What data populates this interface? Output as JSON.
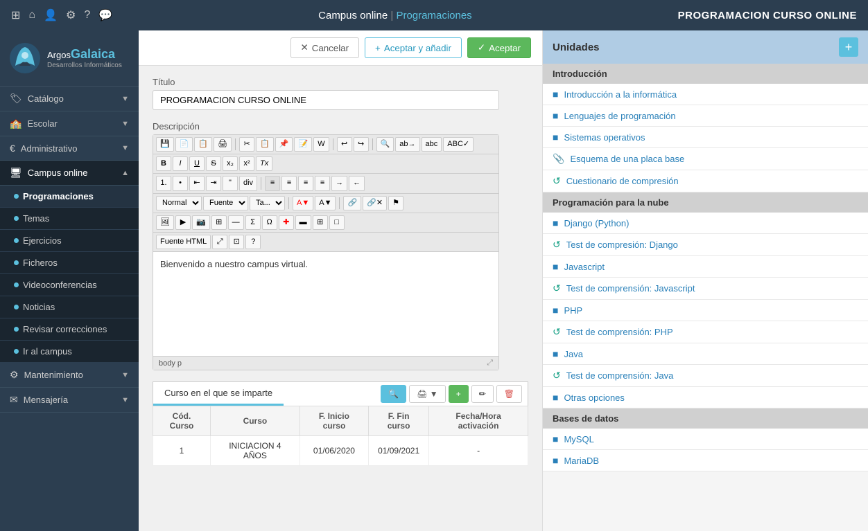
{
  "navbar": {
    "title": "Campus online",
    "separator": "|",
    "subtitle": "Programaciones",
    "page_title": "PROGRAMACION CURSO ONLINE"
  },
  "action_bar": {
    "cancel_label": "Cancelar",
    "add_accept_label": "Aceptar y añadir",
    "accept_label": "Aceptar"
  },
  "form": {
    "title_label": "Título",
    "title_value": "PROGRAMACION CURSO ONLINE",
    "desc_label": "Descripción",
    "editor_content": "Bienvenido a nuestro campus virtual.",
    "editor_footer_left": "body  p",
    "editor_style_select": "Normal",
    "editor_font_select": "Fuente",
    "editor_size_select": "Ta..."
  },
  "course_section": {
    "tab_label": "Curso en el que se imparte",
    "table_headers": [
      "Cód. Curso",
      "Curso",
      "F. Inicio curso",
      "F. Fin curso",
      "Fecha/Hora activación"
    ],
    "table_rows": [
      {
        "cod": "1",
        "curso": "INICIACION 4 AÑOS",
        "f_inicio": "01/06/2020",
        "f_fin": "01/09/2021",
        "activacion": "-"
      }
    ]
  },
  "sidebar": {
    "logo_argos": "Argos",
    "logo_galaica": "Galaica",
    "logo_sub": "Desarrollos Informáticos",
    "menu_items": [
      {
        "label": "Catálogo",
        "icon": "🏷",
        "has_arrow": true
      },
      {
        "label": "Escolar",
        "icon": "🏫",
        "has_arrow": true
      },
      {
        "label": "Administrativo",
        "icon": "€",
        "has_arrow": true
      },
      {
        "label": "Campus online",
        "icon": "🖥",
        "has_arrow": true,
        "active": true
      },
      {
        "label": "Mantenimiento",
        "icon": "⚙",
        "has_arrow": true
      },
      {
        "label": "Mensajería",
        "icon": "✉",
        "has_arrow": true
      }
    ],
    "sub_items": [
      {
        "label": "Programaciones",
        "active": true
      },
      {
        "label": "Temas"
      },
      {
        "label": "Ejercicios"
      },
      {
        "label": "Ficheros"
      },
      {
        "label": "Videoconferencias"
      },
      {
        "label": "Noticias"
      },
      {
        "label": "Revisar correcciones"
      },
      {
        "label": "Ir al campus"
      }
    ]
  },
  "right_panel": {
    "header": "Unidades",
    "add_btn": "+",
    "sections": [
      {
        "title": "Introducción",
        "items": [
          {
            "icon": "book",
            "text": "Introducción a la informática",
            "type": "book"
          },
          {
            "icon": "book",
            "text": "Lenguajes de programación",
            "type": "book"
          },
          {
            "icon": "book",
            "text": "Sistemas operativos",
            "type": "book"
          },
          {
            "icon": "attach",
            "text": "Esquema de una placa base",
            "type": "attach"
          },
          {
            "icon": "test",
            "text": "Cuestionario de compresión",
            "type": "test"
          }
        ]
      },
      {
        "title": "Programación para la nube",
        "items": [
          {
            "icon": "book",
            "text": "Django (Python)",
            "type": "book"
          },
          {
            "icon": "test",
            "text": "Test de compresión: Django",
            "type": "test"
          },
          {
            "icon": "book",
            "text": "Javascript",
            "type": "book"
          },
          {
            "icon": "test",
            "text": "Test de comprensión: Javascript",
            "type": "test"
          },
          {
            "icon": "book",
            "text": "PHP",
            "type": "book"
          },
          {
            "icon": "test",
            "text": "Test de comprensión: PHP",
            "type": "test"
          },
          {
            "icon": "book",
            "text": "Java",
            "type": "book"
          },
          {
            "icon": "test",
            "text": "Test de comprensión: Java",
            "type": "test"
          },
          {
            "icon": "book",
            "text": "Otras opciones",
            "type": "book"
          }
        ]
      },
      {
        "title": "Bases de datos",
        "items": [
          {
            "icon": "book",
            "text": "MySQL",
            "type": "book"
          },
          {
            "icon": "book",
            "text": "MariaDB",
            "type": "book"
          }
        ]
      }
    ]
  }
}
